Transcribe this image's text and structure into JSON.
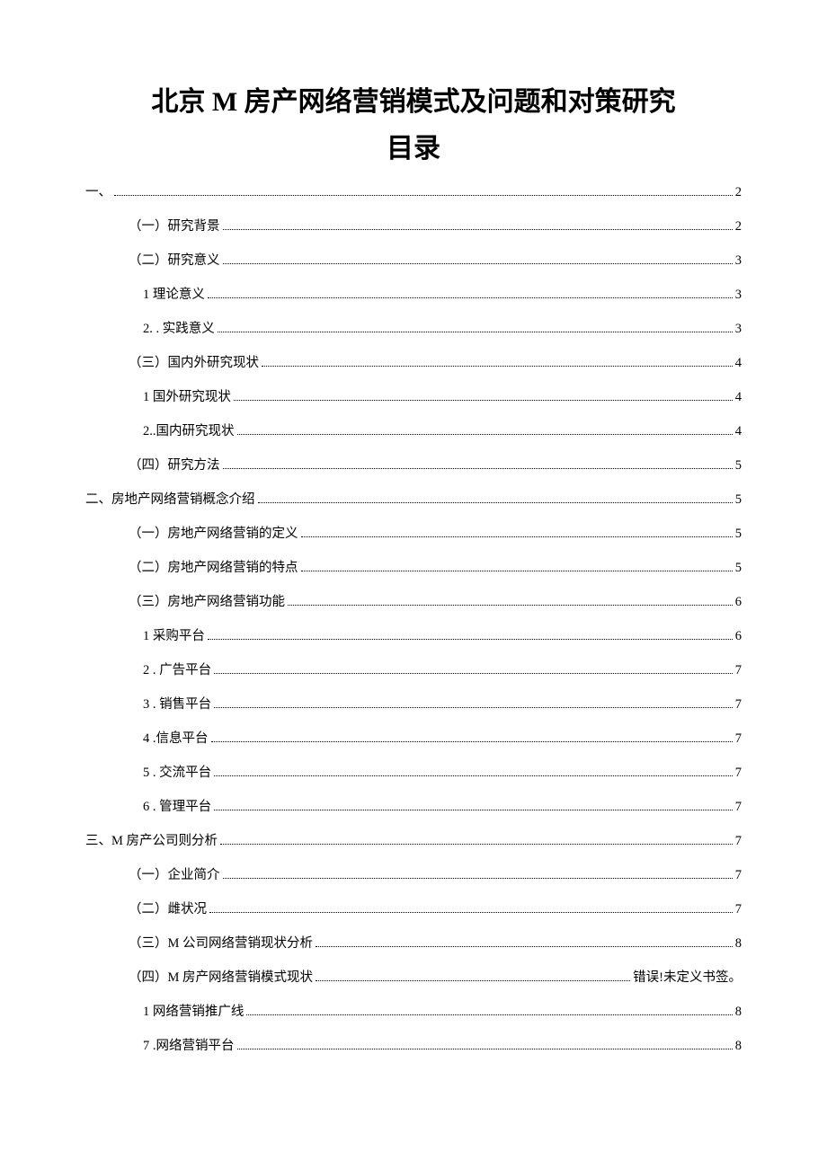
{
  "title": "北京 M 房产网络营销模式及问题和对策研究",
  "subtitle": "目录",
  "toc": [
    {
      "level": 0,
      "label": "一、",
      "page": "2"
    },
    {
      "level": 1,
      "label": "（一）研究背景",
      "page": "2"
    },
    {
      "level": 1,
      "label": "（二）研究意义",
      "page": "3"
    },
    {
      "level": 2,
      "label": "1 理论意义",
      "page": "3"
    },
    {
      "level": 2,
      "label": "2. . 实践意义",
      "page": "3"
    },
    {
      "level": 1,
      "label": "（三）国内外研究现状",
      "page": "4"
    },
    {
      "level": 2,
      "label": "1 国外研究现状",
      "page": "4"
    },
    {
      "level": 2,
      "label": "2..国内研究现状",
      "page": "4"
    },
    {
      "level": 1,
      "label": "（四）研究方法",
      "page": "5"
    },
    {
      "level": 0,
      "label": "二、房地产网络营销概念介绍",
      "page": "5"
    },
    {
      "level": 1,
      "label": "（一）房地产网络营销的定义",
      "page": "5"
    },
    {
      "level": 1,
      "label": "（二）房地产网络营销的特点",
      "page": "5"
    },
    {
      "level": 1,
      "label": "（三）房地产网络营销功能",
      "page": "6"
    },
    {
      "level": 2,
      "label": "1 采购平台",
      "page": "6"
    },
    {
      "level": 2,
      "label": "2   . 广告平台",
      "page": "7"
    },
    {
      "level": 2,
      "label": "3    . 销售平台",
      "page": "7"
    },
    {
      "level": 2,
      "label": "4   .信息平台",
      "page": "7"
    },
    {
      "level": 2,
      "label": "5   . 交流平台",
      "page": "7"
    },
    {
      "level": 2,
      "label": "6    . 管理平台",
      "page": "7"
    },
    {
      "level": 0,
      "label": "三、M 房产公司则分析",
      "page": "7"
    },
    {
      "level": 1,
      "label": "（一）企业简介",
      "page": "7"
    },
    {
      "level": 1,
      "label": "（二）雌状况",
      "page": "7"
    },
    {
      "level": 1,
      "label": "（三）M 公司网络营销现状分析",
      "page": "8"
    },
    {
      "level": 1,
      "label": "（四）M 房产网络营销模式现状",
      "page": "错误!未定义书签。"
    },
    {
      "level": 2,
      "label": "1 网络营销推广线",
      "page": "8"
    },
    {
      "level": 2,
      "label": "7   .网络营销平台",
      "page": "8"
    }
  ]
}
